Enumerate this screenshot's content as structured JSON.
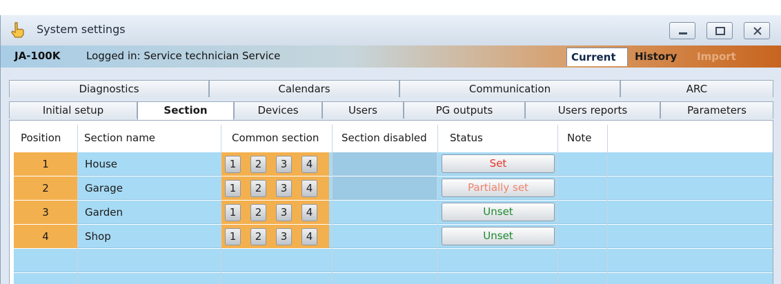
{
  "window": {
    "title": "System settings",
    "icon": "hand-pointer-icon"
  },
  "header": {
    "model": "JA-100K",
    "login_text": "Logged in: Service technician Service",
    "tabs": [
      "Current",
      "History",
      "Import"
    ]
  },
  "tabs_row1": [
    "Diagnostics",
    "Calendars",
    "Communication",
    "ARC"
  ],
  "tabs_row2": [
    "Initial setup",
    "Section",
    "Devices",
    "Users",
    "PG outputs",
    "Users reports",
    "Parameters"
  ],
  "active_tab": "Section",
  "table": {
    "columns": [
      "Position",
      "Section name",
      "Common section",
      "Section disabled",
      "Status",
      "Note"
    ],
    "common_section_buttons": [
      "1",
      "2",
      "3",
      "4"
    ],
    "rows": [
      {
        "position": "1",
        "name": "House",
        "status": "Set",
        "status_color": "#e8312a",
        "disabled_shaded": true
      },
      {
        "position": "2",
        "name": "Garage",
        "status": "Partially set",
        "status_color": "#f0826c",
        "disabled_shaded": true
      },
      {
        "position": "3",
        "name": "Garden",
        "status": "Unset",
        "status_color": "#1f8a2e",
        "disabled_shaded": false
      },
      {
        "position": "4",
        "name": "Shop",
        "status": "Unset",
        "status_color": "#1f8a2e",
        "disabled_shaded": false
      }
    ]
  },
  "colors": {
    "position_cell": "#f3b04f",
    "row_background": "#a7daf4",
    "header_gradient_end": "#c7641f"
  }
}
